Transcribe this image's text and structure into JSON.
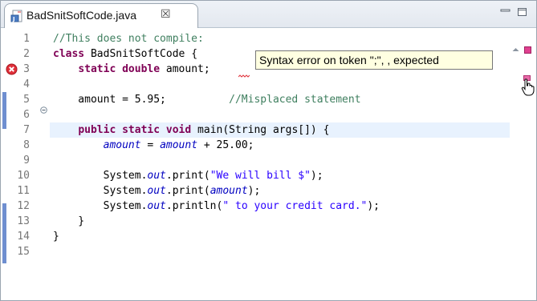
{
  "tab": {
    "title": "BadSnitSoftCode.java",
    "close_glyph": "☒"
  },
  "editor": {
    "lines": [
      {
        "num": "1",
        "code": "//This does not compile:"
      },
      {
        "num": "2",
        "code": "class BadSnitSoftCode {"
      },
      {
        "num": "3",
        "code": "    static double amount;"
      },
      {
        "num": "4",
        "code": ""
      },
      {
        "num": "5",
        "code": "    amount = 5.95;          //Misplaced statement"
      },
      {
        "num": "6",
        "code": ""
      },
      {
        "num": "7",
        "code": "    public static void main(String args[]) {"
      },
      {
        "num": "8",
        "code": "        amount = amount + 25.00;"
      },
      {
        "num": "9",
        "code": ""
      },
      {
        "num": "10",
        "code": "        System.out.print(\"We will bill $\");"
      },
      {
        "num": "11",
        "code": "        System.out.print(amount);"
      },
      {
        "num": "12",
        "code": "        System.out.println(\" to your credit card.\");"
      },
      {
        "num": "13",
        "code": "    }"
      },
      {
        "num": "14",
        "code": "}"
      },
      {
        "num": "15",
        "code": ""
      }
    ],
    "error_tooltip": "Syntax error on token \";\", , expected",
    "current_line": 6
  },
  "colors": {
    "keyword": "#7f0055",
    "comment": "#3f7f5f",
    "string": "#2a00ff",
    "field": "#0000c0",
    "error": "#e0303a",
    "current_line_bg": "#e8f2fe"
  },
  "icons": [
    "java-file-icon",
    "close-icon",
    "minimize-icon",
    "maximize-icon",
    "error-icon",
    "fold-icon",
    "error-marker-icon",
    "hand-cursor-icon"
  ]
}
